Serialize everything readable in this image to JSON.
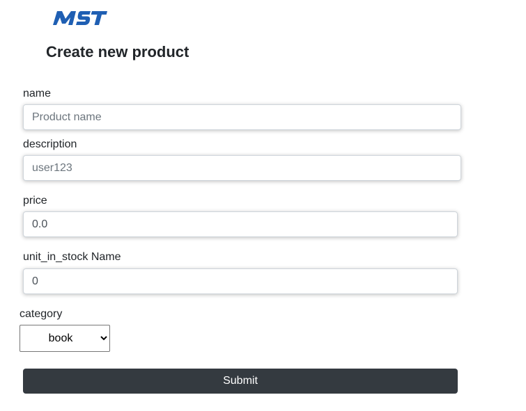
{
  "logo": {
    "text": "MST",
    "color": "#1f5fb3"
  },
  "page": {
    "title": "Create new product"
  },
  "form": {
    "name": {
      "label": "name",
      "placeholder": "Product name",
      "value": ""
    },
    "description": {
      "label": "description",
      "placeholder": "user123",
      "value": ""
    },
    "price": {
      "label": "price",
      "value": "0.0"
    },
    "unit_in_stock": {
      "label": "unit_in_stock Name",
      "value": "0"
    },
    "category": {
      "label": "category",
      "selected": "book"
    },
    "submit_label": "Submit"
  },
  "colors": {
    "button_bg": "#343a40",
    "brand": "#1f5fb3"
  }
}
